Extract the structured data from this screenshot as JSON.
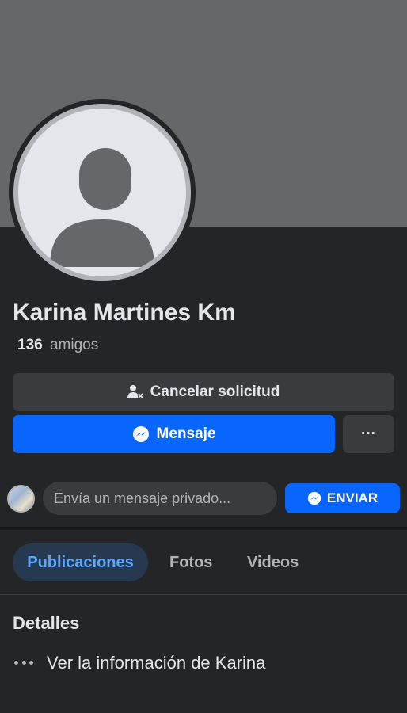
{
  "profile": {
    "name": "Karina Martines Km",
    "friends_count": "136",
    "friends_label": "amigos"
  },
  "actions": {
    "cancel_request_label": "Cancelar solicitud",
    "message_label": "Mensaje",
    "more_label": "···"
  },
  "composer": {
    "placeholder": "Envía un mensaje privado...",
    "send_label": "ENVIAR"
  },
  "tabs": [
    {
      "label": "Publicaciones",
      "active": true
    },
    {
      "label": "Fotos",
      "active": false
    },
    {
      "label": "Videos",
      "active": false
    }
  ],
  "details": {
    "title": "Detalles",
    "link_label": "Ver la información de Karina"
  },
  "colors": {
    "background": "#242526",
    "cover": "#65676b",
    "primary": "#0866ff",
    "secondary_button": "#3a3b3c",
    "active_tab_bg": "#263951",
    "active_tab_text": "#5aa7ff"
  },
  "icons": {
    "cancel": "person-remove-icon",
    "messenger": "messenger-icon",
    "more": "more-dots-icon"
  }
}
